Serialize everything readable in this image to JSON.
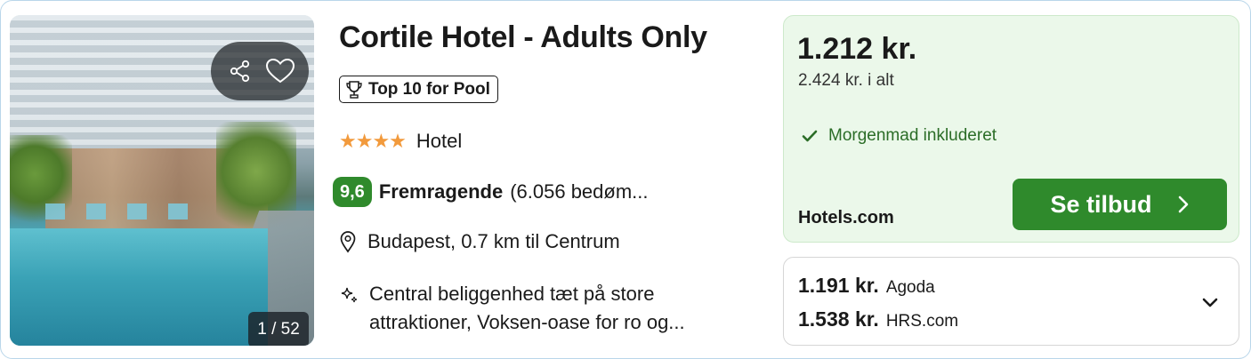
{
  "hotel": {
    "name": "Cortile Hotel - Adults Only",
    "badge": "Top 10 for Pool",
    "stars": "★★★★",
    "type": "Hotel",
    "score": "9,6",
    "rating_label": "Fremragende",
    "rating_count": "(6.056 bedøm...",
    "location": "Budapest, 0.7 km til Centrum",
    "feature": "Central beliggenhed tæt på store attraktioner, Voksen-oase for ro og..."
  },
  "photo": {
    "counter": "1 / 52",
    "share_icon": "share-icon",
    "favorite_icon": "heart-icon"
  },
  "deal": {
    "price": "1.212 kr.",
    "total": "2.424 kr. i alt",
    "perk": "Morgenmad inkluderet",
    "provider": "Hotels.com",
    "cta_label": "Se tilbud"
  },
  "other_offers": [
    {
      "price": "1.191 kr.",
      "source": "Agoda"
    },
    {
      "price": "1.538 kr.",
      "source": "HRS.com"
    }
  ],
  "colors": {
    "accent_green": "#2f8a2c",
    "deal_bg": "#ebf8ea",
    "star": "#f29a3c",
    "border": "#b9d6ea"
  }
}
